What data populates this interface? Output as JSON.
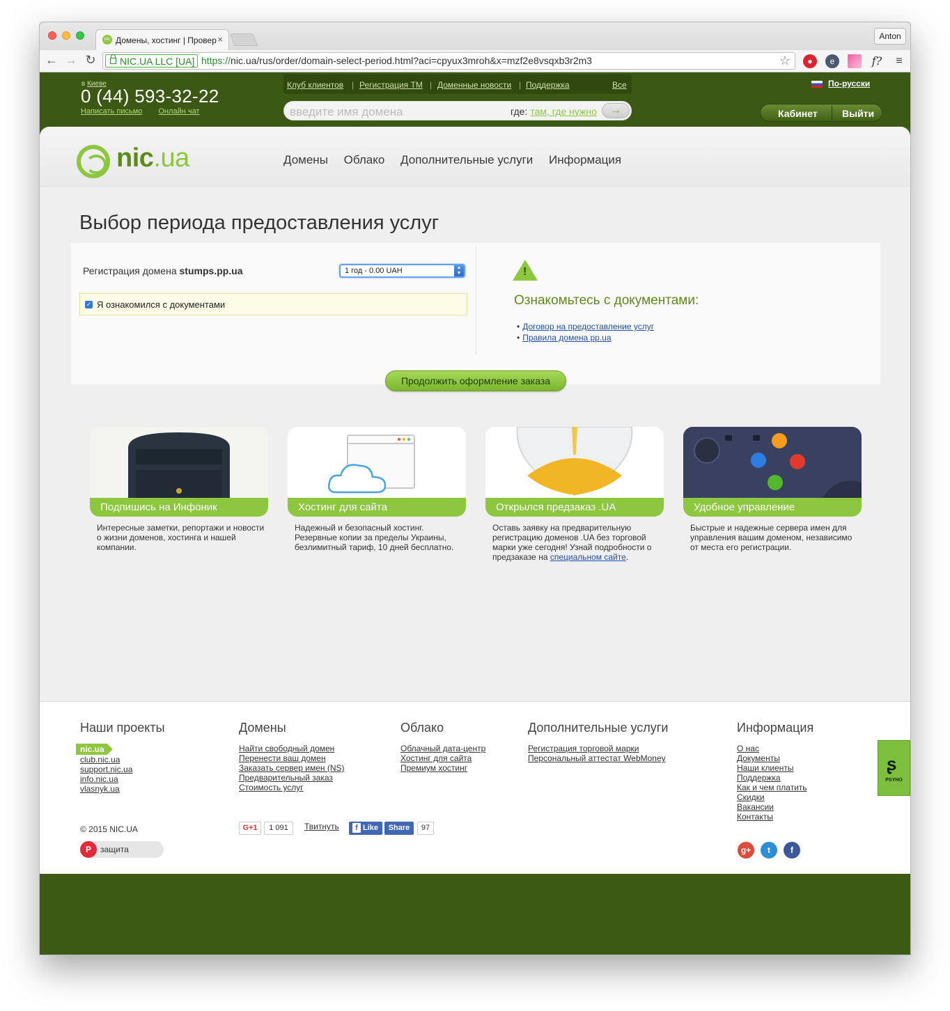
{
  "browser": {
    "tab_title": "Домены, хостинг | Провер",
    "tab_close": "×",
    "profile": "Anton",
    "secure_label": "NIC.UA LLC [UA]",
    "url_proto": "https://",
    "url_rest": "nic.ua/rus/order/domain-select-period.html?aci=cpyux3mroh&x=mzf2e8vsqxb3r2m3"
  },
  "header": {
    "city_prefix": "в ",
    "city": "Киеве",
    "phone": "0 (44) 593-32-22",
    "write_letter": "Написать письмо",
    "online_chat": "Онлайн чат",
    "topnav": [
      "Клуб клиентов",
      "Регистрация ТМ",
      "Доменные новости",
      "Поддержка",
      "Все"
    ],
    "search_placeholder": "введите имя домена",
    "search_where": "где:",
    "search_where_value": "там, где нужно",
    "search_go": "→",
    "language": "По-русски",
    "cabinet": "Кабинет",
    "logout": "Выйти"
  },
  "logo": {
    "part1": "nic",
    "part2": ".ua"
  },
  "mainnav": [
    "Домены",
    "Облако",
    "Дополнительные услуги",
    "Информация"
  ],
  "page_title": "Выбор периода предоставления услуг",
  "order": {
    "reg_label": "Регистрация домена",
    "domain": "stumps.pp.ua",
    "period_selected": "1 год - 0.00 UAH",
    "agree_text": "Я ознакомился с документами",
    "docs_title": "Ознакомьтесь с документами:",
    "docs": [
      "Договор на предоставление услуг",
      "Правила домена pp.ua"
    ],
    "continue": "Продолжить оформление заказа"
  },
  "promos": [
    {
      "title": "Подпишись на Инфоник",
      "desc": "Интересные заметки, репортажи и новости о жизни доменов, хостинга и нашей компании."
    },
    {
      "title": "Хостинг для сайта",
      "desc": "Надежный и безопасный хостинг. Резервные копии за пределы Украины, безлимитный тариф, 10 дней бесплатно."
    },
    {
      "title": "Открылся предзаказ .UA",
      "desc": "Оставь заявку на предварительную регистрацию доменов .UA без торговой марки уже сегодня! Узнай подробности о предзаказе на ",
      "link": "специальном сайте",
      "end": "."
    },
    {
      "title": "Удобное управление",
      "desc": "Быстрые и надежные сервера имен для управления вашим доменом, независимо от места его регистрации."
    }
  ],
  "footer": {
    "projects_title": "Наши проекты",
    "projects": [
      "nic.ua",
      "club.nic.ua",
      "support.nic.ua",
      "info.nic.ua",
      "vlasnyk.ua"
    ],
    "domains_title": "Домены",
    "domains": [
      "Найти свободный домен",
      "Перенести ваш домен",
      "Заказать сервер имен (NS)",
      "Предварительный заказ",
      "Стоимость услуг"
    ],
    "cloud_title": "Облако",
    "cloud": [
      "Облачный дата-центр",
      "Хостинг для сайта",
      "Премиум хостинг"
    ],
    "extra_title": "Дополнительные услуги",
    "extra": [
      "Регистрация торговой марки",
      "Персональный аттестат WebMoney"
    ],
    "info_title": "Информация",
    "info": [
      "О нас",
      "Документы",
      "Наши клиенты",
      "Поддержка",
      "Как и чем платить",
      "Скидки",
      "Вакансии",
      "Контакты"
    ],
    "copyright": "© 2015 NIC.UA",
    "protect": "защита",
    "gplus": "G+1",
    "gplus_count": "1 091",
    "tweet": "Твитнуть",
    "fb_like": "Like",
    "fb_share": "Share",
    "fb_count": "97",
    "psyho": "PSYHO"
  },
  "colors": {
    "brand_green": "#8dc63f",
    "header_dark": "#3b5914",
    "link_blue": "#1f4fa8"
  }
}
